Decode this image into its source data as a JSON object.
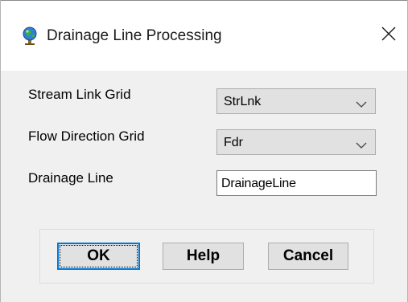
{
  "window": {
    "title": "Drainage Line Processing",
    "icon": "globe-pin-icon",
    "close_icon": "close-icon"
  },
  "form": {
    "stream_link_grid": {
      "label": "Stream Link Grid",
      "value": "StrLnk"
    },
    "flow_direction_grid": {
      "label": "Flow Direction Grid",
      "value": "Fdr"
    },
    "drainage_line": {
      "label": "Drainage Line",
      "value": "DrainageLine"
    }
  },
  "buttons": {
    "ok": "OK",
    "help": "Help",
    "cancel": "Cancel"
  },
  "colors": {
    "accent": "#0078d7",
    "panel_bg": "#f0f0f0",
    "button_bg": "#e1e1e1"
  }
}
